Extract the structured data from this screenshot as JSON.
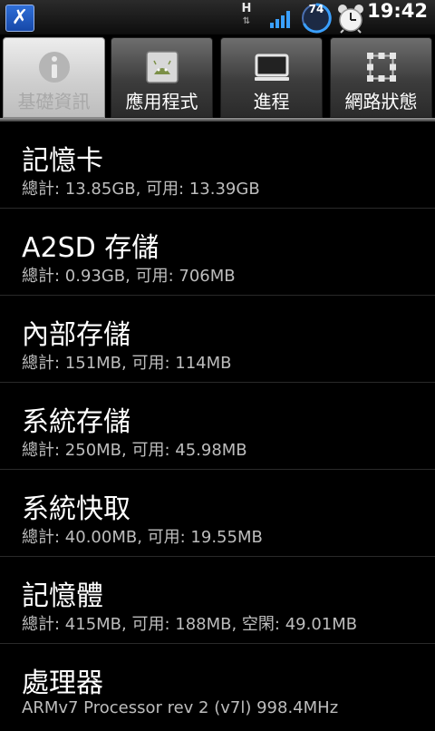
{
  "statusbar": {
    "network_type": "H",
    "network_arrows": "⇅",
    "battery_level": "74",
    "time": "19:42"
  },
  "tabs": [
    {
      "label": "基礎資訊",
      "icon": "info-icon",
      "active": true
    },
    {
      "label": "應用程式",
      "icon": "android-app-icon",
      "active": false
    },
    {
      "label": "進程",
      "icon": "monitor-icon",
      "active": false
    },
    {
      "label": "網路狀態",
      "icon": "network-grid-icon",
      "active": false
    }
  ],
  "items": [
    {
      "title": "記憶卡",
      "detail": "總計: 13.85GB, 可用: 13.39GB"
    },
    {
      "title": "A2SD 存儲",
      "detail": "總計: 0.93GB, 可用: 706MB"
    },
    {
      "title": "內部存儲",
      "detail": "總計: 151MB, 可用: 114MB"
    },
    {
      "title": "系統存儲",
      "detail": "總計: 250MB, 可用: 45.98MB"
    },
    {
      "title": "系統快取",
      "detail": "總計: 40.00MB, 可用: 19.55MB"
    },
    {
      "title": "記憶體",
      "detail": "總計: 415MB, 可用: 188MB, 空閑: 49.01MB"
    },
    {
      "title": "處理器",
      "detail": "ARMv7 Processor rev 2 (v7l)  998.4MHz"
    }
  ],
  "colors": {
    "background": "#000000",
    "accent_blue": "#2f6fd8",
    "signal_blue": "#3aa0ff"
  }
}
